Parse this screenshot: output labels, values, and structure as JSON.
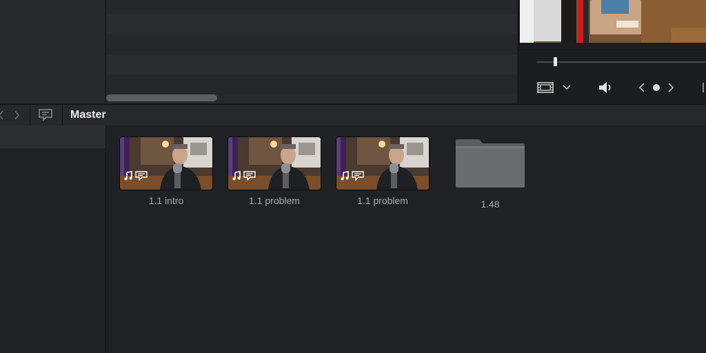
{
  "bin_header": {
    "title": "Master",
    "nav_back_icon": "chevron-left-icon",
    "nav_forward_icon": "chevron-right-icon",
    "subtitles_icon": "caption-bubble-icon"
  },
  "viewer": {
    "controls": [
      {
        "name": "filmstrip-icon"
      },
      {
        "name": "chevron-down-icon"
      },
      {
        "name": "speaker-icon"
      },
      {
        "name": "prev-icon"
      },
      {
        "name": "dot-icon"
      },
      {
        "name": "next-icon"
      }
    ]
  },
  "media_pool": {
    "clips": [
      {
        "label": "1.1 intro",
        "has_audio": true,
        "has_subtitles": true
      },
      {
        "label": "1.1 problem",
        "has_audio": true,
        "has_subtitles": true
      },
      {
        "label": "1.1 problem",
        "has_audio": true,
        "has_subtitles": true
      }
    ],
    "folders": [
      {
        "label": "1.48"
      }
    ]
  },
  "colors": {
    "background": "#1f2023",
    "panel": "#27282b",
    "text": "#a9aaad",
    "title": "#ececec"
  }
}
